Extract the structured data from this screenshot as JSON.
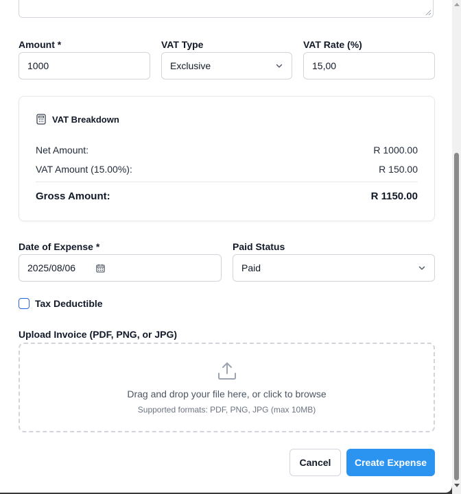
{
  "form": {
    "amount": {
      "label": "Amount *",
      "value": "1000"
    },
    "vat_type": {
      "label": "VAT Type",
      "value": "Exclusive"
    },
    "vat_rate": {
      "label": "VAT Rate (%)",
      "value": "15,00"
    },
    "date": {
      "label": "Date of Expense *",
      "value": "2025/08/06"
    },
    "paid_status": {
      "label": "Paid Status",
      "value": "Paid"
    },
    "tax_deductible": {
      "label": "Tax Deductible",
      "checked": false
    },
    "upload": {
      "label": "Upload Invoice (PDF, PNG, or JPG)",
      "main_text": "Drag and drop your file here, or click to browse",
      "sub_text": "Supported formats: PDF, PNG, JPG (max 10MB)"
    }
  },
  "breakdown": {
    "title": "VAT Breakdown",
    "icon": "calculator-icon",
    "net_label": "Net Amount:",
    "net_value": "R 1000.00",
    "vat_label": "VAT Amount (15.00%):",
    "vat_value": "R 150.00",
    "gross_label": "Gross Amount:",
    "gross_value": "R 1150.00"
  },
  "buttons": {
    "cancel": "Cancel",
    "create": "Create Expense"
  },
  "colors": {
    "primary": "#2b93f0",
    "checkbox_border": "#2563eb",
    "border": "#d1d5db"
  }
}
